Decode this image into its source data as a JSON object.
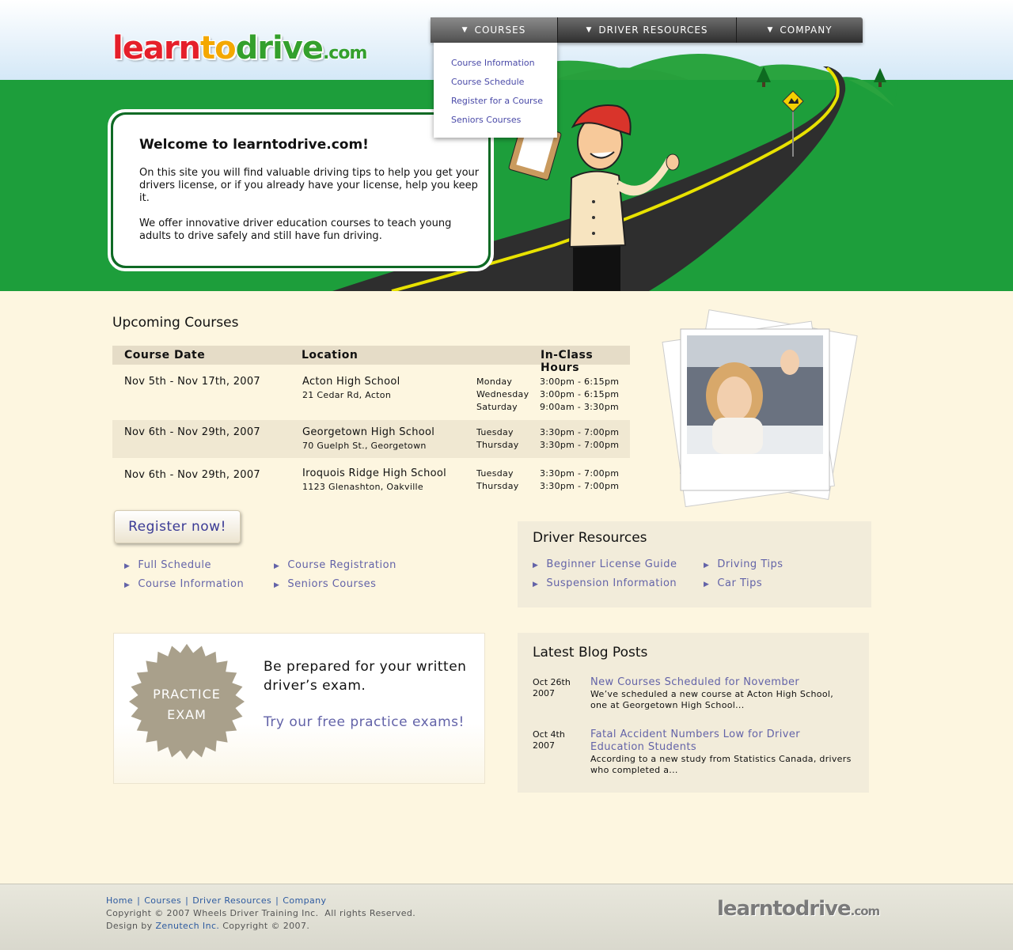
{
  "brand": {
    "logo_learn": "learn",
    "logo_to": "to",
    "logo_drive": "drive",
    "logo_dom": ".com"
  },
  "nav": {
    "items": [
      {
        "label": "COURSES"
      },
      {
        "label": "DRIVER RESOURCES"
      },
      {
        "label": "COMPANY"
      }
    ],
    "dropdown": [
      "Course Information",
      "Course Schedule",
      "Register for a Course",
      "Seniors Courses"
    ]
  },
  "welcome": {
    "title": "Welcome to learntodrive.com!",
    "para1": "On this site you will find valuable driving tips to help you get your drivers license, or if you already have your license, help you keep it.",
    "para2": "We offer innovative driver education courses to teach young adults to drive safely and still have fun driving."
  },
  "courses": {
    "title": "Upcoming Courses",
    "headers": {
      "date": "Course Date",
      "location": "Location",
      "hours": "In-Class Hours"
    },
    "rows": [
      {
        "date": "Nov 5th - Nov 17th, 2007",
        "school": "Acton High School",
        "address": "21 Cedar Rd, Acton",
        "days": [
          "Monday",
          "Wednesday",
          "Saturday"
        ],
        "times": [
          "3:00pm - 6:15pm",
          "3:00pm - 6:15pm",
          "9:00am - 3:30pm"
        ]
      },
      {
        "date": "Nov 6th - Nov 29th, 2007",
        "school": "Georgetown High School",
        "address": "70 Guelph St., Georgetown",
        "days": [
          "Tuesday",
          "Thursday"
        ],
        "times": [
          "3:30pm - 7:00pm",
          "3:30pm - 7:00pm"
        ]
      },
      {
        "date": "Nov 6th - Nov 29th, 2007",
        "school": "Iroquois Ridge High School",
        "address": "1123 Glenashton, Oakville",
        "days": [
          "Tuesday",
          "Thursday"
        ],
        "times": [
          "3:30pm - 7:00pm",
          "3:30pm - 7:00pm"
        ]
      }
    ]
  },
  "register": {
    "button": "Register now!",
    "links": [
      "Full Schedule",
      "Course Information",
      "Course Registration",
      "Seniors Courses"
    ]
  },
  "resources": {
    "title": "Driver Resources",
    "links": [
      "Beginner License Guide",
      "Suspension Information",
      "Driving Tips",
      "Car Tips"
    ]
  },
  "exam": {
    "seal_line1": "PRACTICE",
    "seal_line2": "EXAM",
    "heading": "Be prepared for your written driver’s exam.",
    "link": "Try our free practice exams!"
  },
  "blog": {
    "title": "Latest Blog Posts",
    "posts": [
      {
        "date_line1": "Oct 26th",
        "date_line2": "2007",
        "title": "New Courses Scheduled for November",
        "excerpt": "We’ve scheduled a new course at Acton High School, one at Georgetown High School..."
      },
      {
        "date_line1": "Oct 4th",
        "date_line2": "2007",
        "title": "Fatal Accident Numbers Low for Driver Education Students",
        "excerpt": "According to a new study from Statistics Canada, drivers who completed a..."
      }
    ]
  },
  "footer": {
    "links": [
      "Home",
      "Courses",
      "Driver Resources",
      "Company"
    ],
    "copyright": "Copyright © 2007 Wheels Driver Training Inc.  All rights Reserved.",
    "design_prefix": "Design by",
    "design_link": "Zenutech Inc.",
    "design_suffix": "Copyright © 2007.",
    "logo_text": "learntodrive",
    "logo_dom": ".com"
  },
  "colors": {
    "grass": "#1d9e3b",
    "link": "#6363a8",
    "cream": "#fdf6e0",
    "panel": "#f2ecda"
  },
  "icons": [
    "triangle-down-icon",
    "bullet-arrow-icon",
    "road-sign-icon",
    "tree-icon"
  ]
}
